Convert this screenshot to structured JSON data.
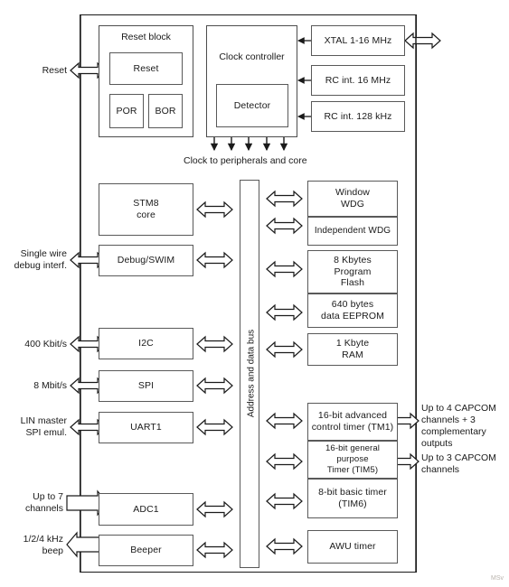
{
  "figure": {
    "id_label": "MSv",
    "caption_clock": "Clock to peripherals and core",
    "bus_label": "Address and data bus"
  },
  "reset_block": {
    "title": "Reset block",
    "items": [
      {
        "label": "Reset"
      },
      {
        "label": "POR"
      },
      {
        "label": "BOR"
      }
    ]
  },
  "clock_block": {
    "title": "Clock controller",
    "detector": "Detector",
    "sources": [
      {
        "label": "XTAL 1-16 MHz"
      },
      {
        "label": "RC int. 16 MHz"
      },
      {
        "label": "RC int. 128 kHz"
      }
    ]
  },
  "core_blocks": [
    {
      "label": "STM8\ncore"
    },
    {
      "label": "Debug/SWIM"
    }
  ],
  "peripherals": [
    {
      "label": "I2C"
    },
    {
      "label": "SPI"
    },
    {
      "label": "UART1"
    },
    {
      "label": "ADC1"
    },
    {
      "label": "Beeper"
    }
  ],
  "left_labels": [
    {
      "label": "Reset"
    },
    {
      "label": "Single wire\ndebug interf."
    },
    {
      "label": "400 Kbit/s"
    },
    {
      "label": "8 Mbit/s"
    },
    {
      "label": "LIN master\nSPI emul."
    },
    {
      "label": "Up to 7\nchannels"
    },
    {
      "label": "1/2/4 kHz\nbeep"
    }
  ],
  "memory_blocks": [
    {
      "label": "Window\nWDG"
    },
    {
      "label": "Independent WDG"
    },
    {
      "label": "8 Kbytes\nProgram\nFlash"
    },
    {
      "label": "640 bytes\ndata EEPROM"
    },
    {
      "label": "1 Kbyte\nRAM"
    }
  ],
  "timer_blocks": [
    {
      "label": "16-bit advanced\ncontrol timer (TM1)"
    },
    {
      "label": "16-bit general purpose\nTimer (TIM5)"
    },
    {
      "label": "8-bit basic timer\n(TIM6)"
    },
    {
      "label": "AWU timer"
    }
  ],
  "right_labels": [
    {
      "label": "Up to 4 CAPCOM\nchannels + 3\ncomplementary\noutputs"
    },
    {
      "label": "Up to 3 CAPCOM\nchannels"
    }
  ],
  "colors": {
    "frame": "#1a1a1a",
    "box_border": "#595959",
    "text": "#1a1a1a",
    "background": "#ffffff"
  }
}
